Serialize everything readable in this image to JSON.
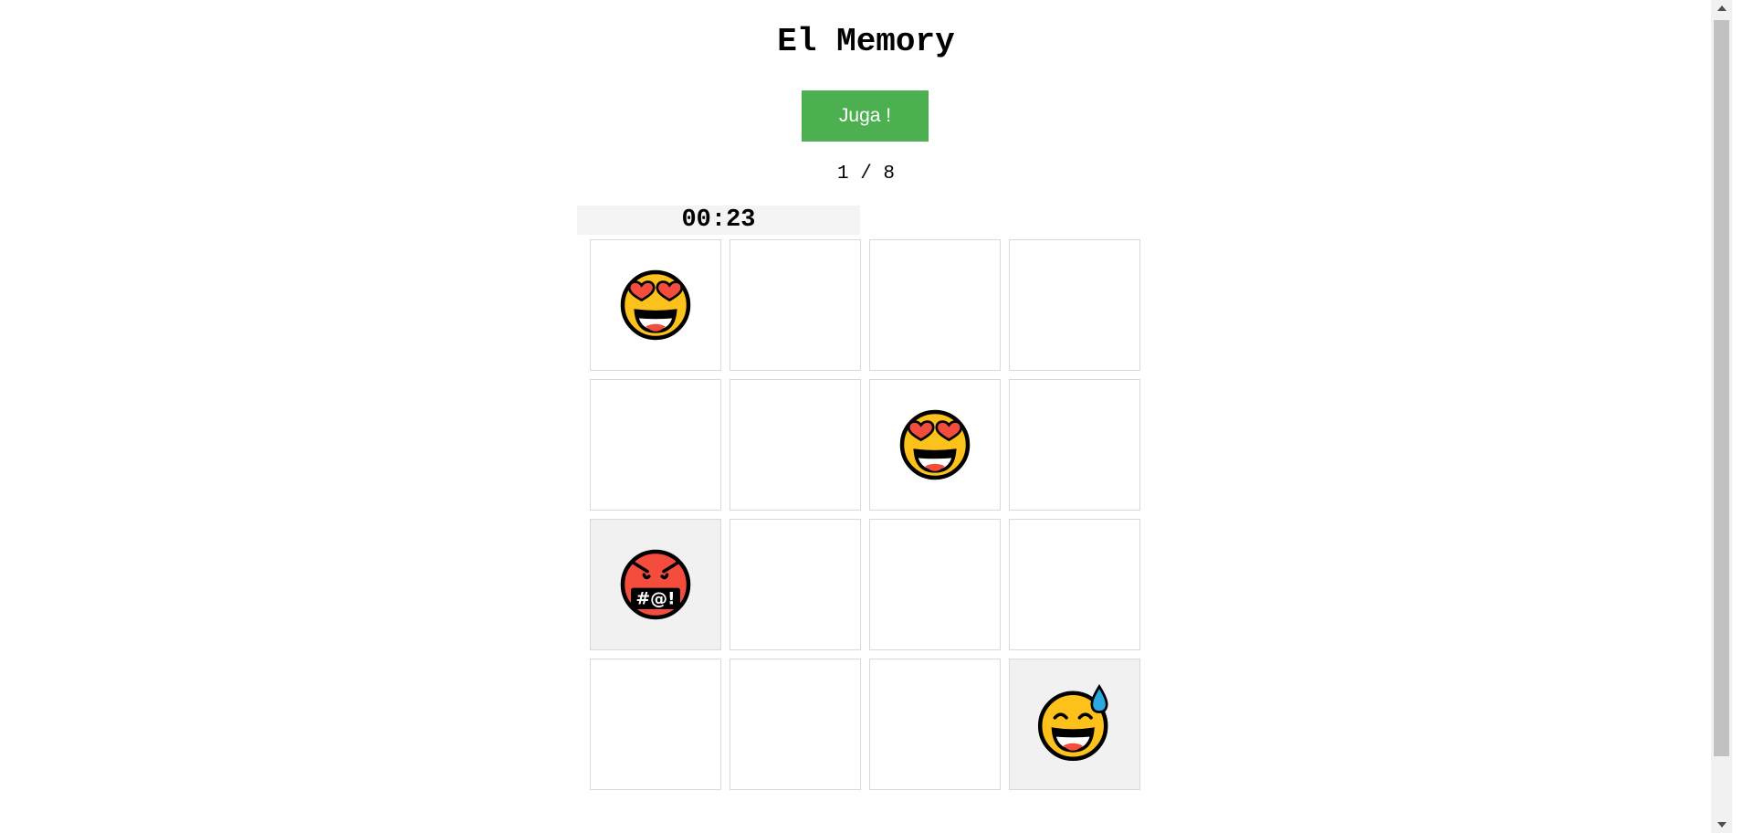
{
  "game": {
    "title": "El Memory",
    "play_label": "Juga !",
    "progress": "1 / 8",
    "timer": "00:23"
  },
  "board": {
    "rows": 4,
    "columns": 4,
    "cards": [
      {
        "state": "face-up",
        "icon": "heart-eyes-emoji-icon"
      },
      {
        "state": "face-down",
        "icon": ""
      },
      {
        "state": "face-down",
        "icon": ""
      },
      {
        "state": "face-down",
        "icon": ""
      },
      {
        "state": "face-down",
        "icon": ""
      },
      {
        "state": "face-down",
        "icon": ""
      },
      {
        "state": "face-up",
        "icon": "heart-eyes-emoji-icon"
      },
      {
        "state": "face-down",
        "icon": ""
      },
      {
        "state": "face-up-shaded",
        "icon": "cursing-face-emoji-icon",
        "symbol_text": "#@!"
      },
      {
        "state": "face-down",
        "icon": ""
      },
      {
        "state": "face-down",
        "icon": ""
      },
      {
        "state": "face-down",
        "icon": ""
      },
      {
        "state": "face-down",
        "icon": ""
      },
      {
        "state": "face-down",
        "icon": ""
      },
      {
        "state": "face-down",
        "icon": ""
      },
      {
        "state": "face-up-shaded",
        "icon": "grinning-sweat-emoji-icon"
      }
    ]
  },
  "colors": {
    "play_button": "#4caf50",
    "emoji_yellow": "#fcc21b",
    "emoji_red": "#f44d3e",
    "sweat_drop": "#29a9e0",
    "card_border": "#d9d9d9",
    "shaded_card": "#f1f1f1"
  }
}
